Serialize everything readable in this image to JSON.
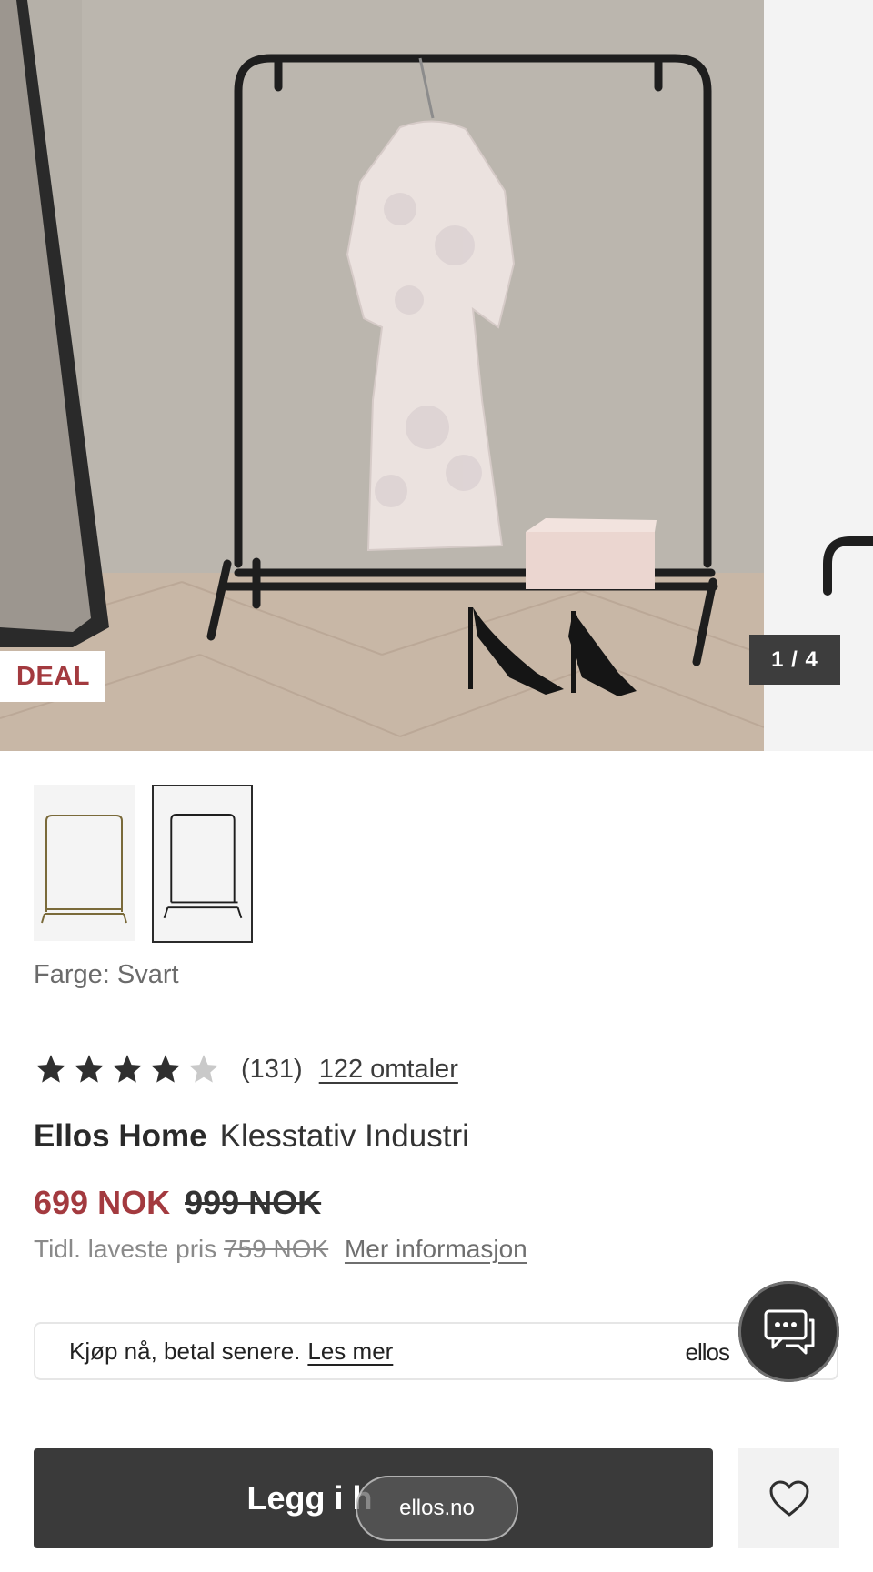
{
  "gallery": {
    "badge": "DEAL",
    "counter": "1 / 4"
  },
  "product": {
    "color_label": "Farge: Svart",
    "rating": {
      "stars_filled": 4,
      "stars_total": 5,
      "count": "(131)",
      "reviews_link": "122 omtaler"
    },
    "brand": "Ellos Home",
    "name": "Klesstativ Industri",
    "price_now": "699 NOK",
    "price_old": "999 NOK",
    "prev_lowest_label": "Tidl. laveste pris",
    "prev_lowest_price": "759 NOK",
    "more_info_link": "Mer informasjon"
  },
  "bnpl": {
    "text": "Kjøp nå, betal senere.",
    "link": "Les mer",
    "logo": "ellos"
  },
  "actions": {
    "add_to_cart": "Legg i h",
    "url": "ellos.no"
  },
  "colors": {
    "accent": "#a33a3f",
    "dark": "#3a3a3a"
  },
  "icons": [
    "star-icon",
    "chat-icon",
    "heart-icon"
  ]
}
